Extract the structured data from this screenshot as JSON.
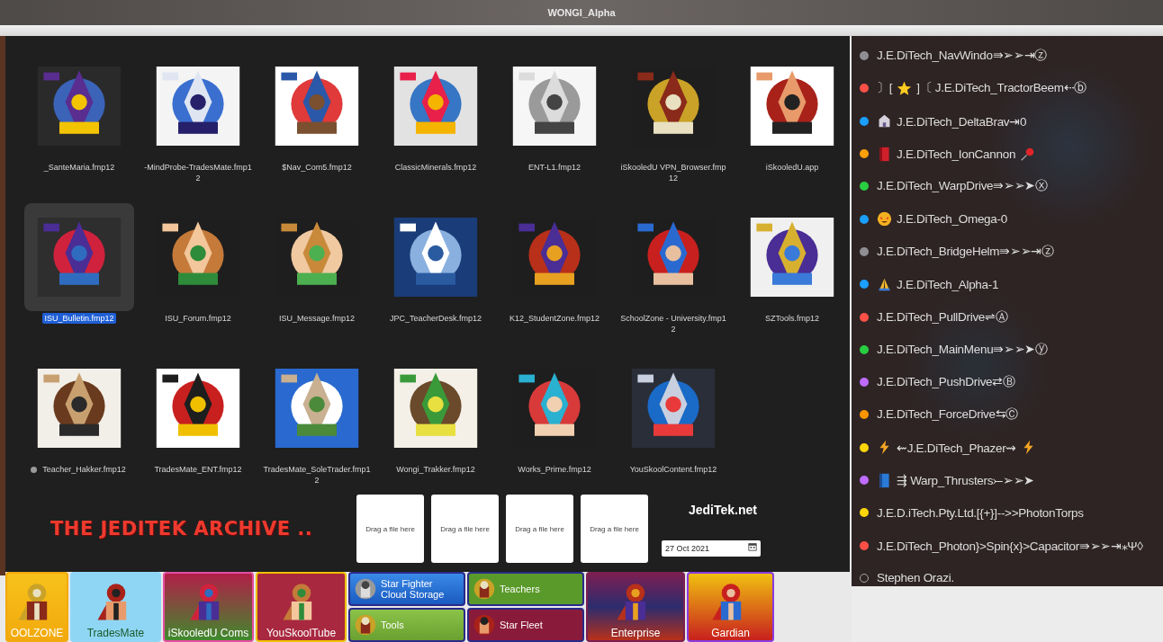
{
  "window": {
    "title": "WONGI_Alpha"
  },
  "files": [
    {
      "name": "_SanteMaria.fmp12",
      "selected": false
    },
    {
      "name": "-MindProbe-TradesMate.fmp12",
      "selected": false
    },
    {
      "name": "$Nav_Com5.fmp12",
      "selected": false
    },
    {
      "name": "ClassicMinerals.fmp12",
      "selected": false
    },
    {
      "name": "ENT-L1.fmp12",
      "selected": false
    },
    {
      "name": "iSkooledU VPN_Browser.fmp12",
      "selected": false
    },
    {
      "name": "iSkooledU.app",
      "selected": false
    },
    {
      "name": "ISU_Bulletin.fmp12",
      "selected": true
    },
    {
      "name": "ISU_Forum.fmp12",
      "selected": false
    },
    {
      "name": "ISU_Message.fmp12",
      "selected": false
    },
    {
      "name": "JPC_TeacherDesk.fmp12",
      "selected": false
    },
    {
      "name": "K12_StudentZone.fmp12",
      "selected": false
    },
    {
      "name": "SchoolZone - University.fmp12",
      "selected": false
    },
    {
      "name": "SZTools.fmp12",
      "selected": false
    },
    {
      "name": "Teacher_Hakker.fmp12",
      "selected": false,
      "color": "#9a9a9a"
    },
    {
      "name": "TradesMate_ENT.fmp12",
      "selected": false
    },
    {
      "name": "TradesMate_SoleTrader.fmp12",
      "selected": false
    },
    {
      "name": "Wongi_Trakker.fmp12",
      "selected": false
    },
    {
      "name": "Works_Prime.fmp12",
      "selected": false
    },
    {
      "name": "YouSkoolContent.fmp12",
      "selected": false
    }
  ],
  "archive_title": "THE JEDITEK ARCHIVE  ..",
  "drop_zones": [
    "Drag a file here",
    "Drag a file here",
    "Drag a file here",
    "Drag a file here"
  ],
  "site": "JediTek.net",
  "date_field": {
    "value": "27 Oct 2021"
  },
  "tiles": [
    {
      "kind": "single",
      "label": "OOLZONE"
    },
    {
      "kind": "single",
      "label": "TradesMate"
    },
    {
      "kind": "single",
      "label": "iSkooledU Coms"
    },
    {
      "kind": "single",
      "label": "YouSkoolTube"
    },
    {
      "kind": "pair",
      "items": [
        {
          "label": "Star Fighter Cloud Storage"
        },
        {
          "label": "Tools"
        }
      ]
    },
    {
      "kind": "pair",
      "items": [
        {
          "label": "Teachers"
        },
        {
          "label": "Star Fleet"
        }
      ]
    },
    {
      "kind": "single",
      "label": "Enterprise"
    },
    {
      "kind": "single",
      "label": "Gardian"
    }
  ],
  "sidebar": {
    "items": [
      {
        "kind": "dot",
        "color": "#8e8e93",
        "text": "J.E.DiTech_NavWindo⇛➢➢⇥ⓩ"
      },
      {
        "kind": "dot",
        "color": "#ff5048",
        "prefix": "〕[",
        "text": "]〔 J.E.DiTech_TractorBeem⇠ⓑ"
      },
      {
        "kind": "dot",
        "color": "#1a9fff",
        "text": "J.E.DiTech_DeltaBrav⇥0"
      },
      {
        "kind": "dot",
        "color": "#ff9f0a",
        "text": "J.E.DiTech_IonCannon"
      },
      {
        "kind": "dot",
        "color": "#28cd41",
        "text": "J.E.DiTech_WarpDrive⇛➢➢➤ⓧ"
      },
      {
        "kind": "dot",
        "color": "#1a9fff",
        "text": "J.E.DiTech_Omega-0"
      },
      {
        "kind": "dot",
        "color": "#8e8e93",
        "text": "J.E.DiTech_BridgeHelm⇛➢➢⇥ⓩ"
      },
      {
        "kind": "dot",
        "color": "#1a9fff",
        "text": "J.E.DiTech_Alpha-1"
      },
      {
        "kind": "dot",
        "color": "#ff5048",
        "text": "J.E.DiTech_PullDrive⇌Ⓐ"
      },
      {
        "kind": "dot",
        "color": "#28cd41",
        "text": "J.E.DiTech_MainMenu⇛➢➢➤ⓨ"
      },
      {
        "kind": "dot",
        "color": "#bf6bff",
        "text": "J.E.DiTech_PushDrive⇄Ⓑ"
      },
      {
        "kind": "dot",
        "color": "#ff9500",
        "text": "J.E.DiTech_ForceDrive⇆Ⓒ"
      },
      {
        "kind": "dot",
        "color": "#ffd60a",
        "text": "⇜J.E.DiTech_Phazer⇝"
      },
      {
        "kind": "dot",
        "color": "#bf6bff",
        "text": "⇶ Warp_Thrusters⤚➢➢➤"
      },
      {
        "kind": "dot",
        "color": "#ffd60a",
        "text": "J.E.D.iTech.Pty.Ltd.[{+}]-->>PhotonTorps"
      },
      {
        "kind": "dot",
        "color": "#ff5048",
        "text": "J.E.DiTech_Photon}>Spin{x}>Capacitor⇛➢➢⇥⁎Ψ◊"
      },
      {
        "kind": "ring",
        "text": "Stephen Orazi."
      }
    ]
  }
}
